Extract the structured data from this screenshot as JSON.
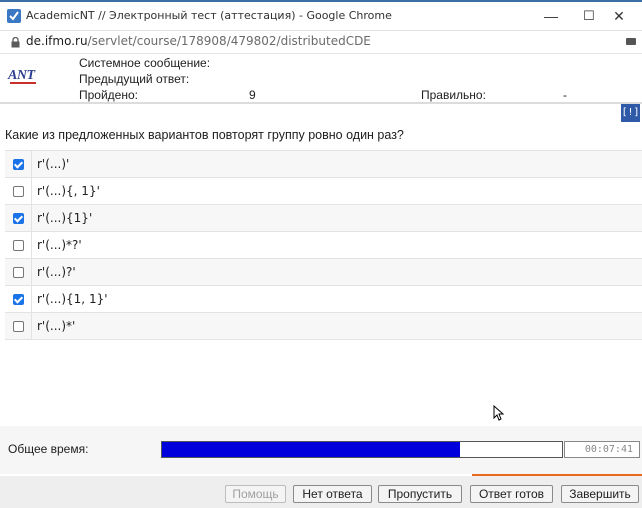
{
  "window": {
    "title": "AcademicNT // Электронный тест (аттестация) - Google Chrome",
    "minimize": "—",
    "maximize": "☐",
    "close": "✕"
  },
  "address": {
    "domain": "de.ifmo.ru",
    "path": "/servlet/course/178908/479802/distributedCDE"
  },
  "header": {
    "logo": "ANT",
    "system_message_label": "Системное сообщение:",
    "previous_answer_label": "Предыдущий ответ:",
    "passed_label": "Пройдено:",
    "passed_value": "9",
    "correct_label": "Правильно:",
    "correct_value": "-"
  },
  "hint_button": "[!]",
  "question": "Какие из предложенных вариантов повторят группу ровно один раз?",
  "options": [
    {
      "text": "r'(...)'",
      "checked": true
    },
    {
      "text": "r'(...){, 1}'",
      "checked": false
    },
    {
      "text": "r'(...){1}'",
      "checked": true
    },
    {
      "text": "r'(...)*?'",
      "checked": false
    },
    {
      "text": "r'(...)?'",
      "checked": false
    },
    {
      "text": "r'(...){1, 1}'",
      "checked": true
    },
    {
      "text": "r'(...)*'",
      "checked": false
    }
  ],
  "timing": {
    "total_time_label": "Общее время:",
    "progress_fraction": 0.745,
    "timer_value": "00:07:41"
  },
  "footer": {
    "help": "Помощь",
    "no_answer": "Нет ответа",
    "skip": "Пропустить",
    "answer_ready": "Ответ готов",
    "finish": "Завершить"
  },
  "colors": {
    "progress_fill": "#0000dd",
    "checkbox_checked": "#1a73e8",
    "accent_orange": "#e86a1d",
    "hint_button": "#2e5aa8"
  }
}
